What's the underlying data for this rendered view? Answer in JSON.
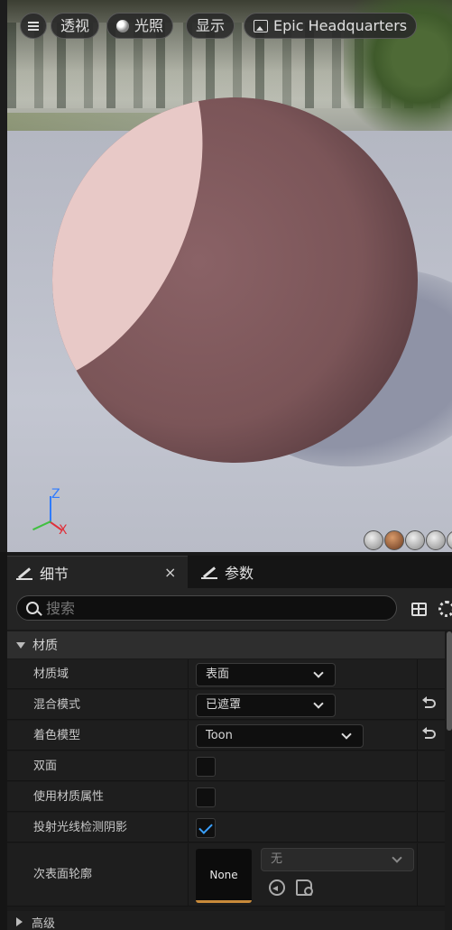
{
  "viewport": {
    "menu_icon": "hamburger-icon",
    "perspective_label": "透视",
    "lit_label": "光照",
    "show_label": "显示",
    "scene_label": "Epic Headquarters",
    "axes": {
      "z": "Z",
      "x": "X"
    },
    "colors": {
      "sphere_lit": "#e8c9c7",
      "sphere_shade": "#7b5558",
      "floor": "#b9bcc7"
    }
  },
  "tabs": [
    {
      "label": "细节",
      "icon": "pencil-icon",
      "active": true
    },
    {
      "label": "参数",
      "icon": "pencil-icon",
      "active": false
    }
  ],
  "search": {
    "placeholder": "搜索"
  },
  "material": {
    "category": "材质",
    "rows": [
      {
        "label": "材质域",
        "value": "表面"
      },
      {
        "label": "混合模式",
        "value": "已遮罩"
      },
      {
        "label": "着色模型",
        "value": "Toon"
      },
      {
        "label": "双面",
        "checked": false
      },
      {
        "label": "使用材质属性",
        "checked": false
      },
      {
        "label": "投射光线检测阴影",
        "checked": true
      },
      {
        "label": "次表面轮廓",
        "thumb": "None",
        "value": "无"
      }
    ]
  },
  "advanced": {
    "label": "高级"
  },
  "accent": "#3aa0ff"
}
